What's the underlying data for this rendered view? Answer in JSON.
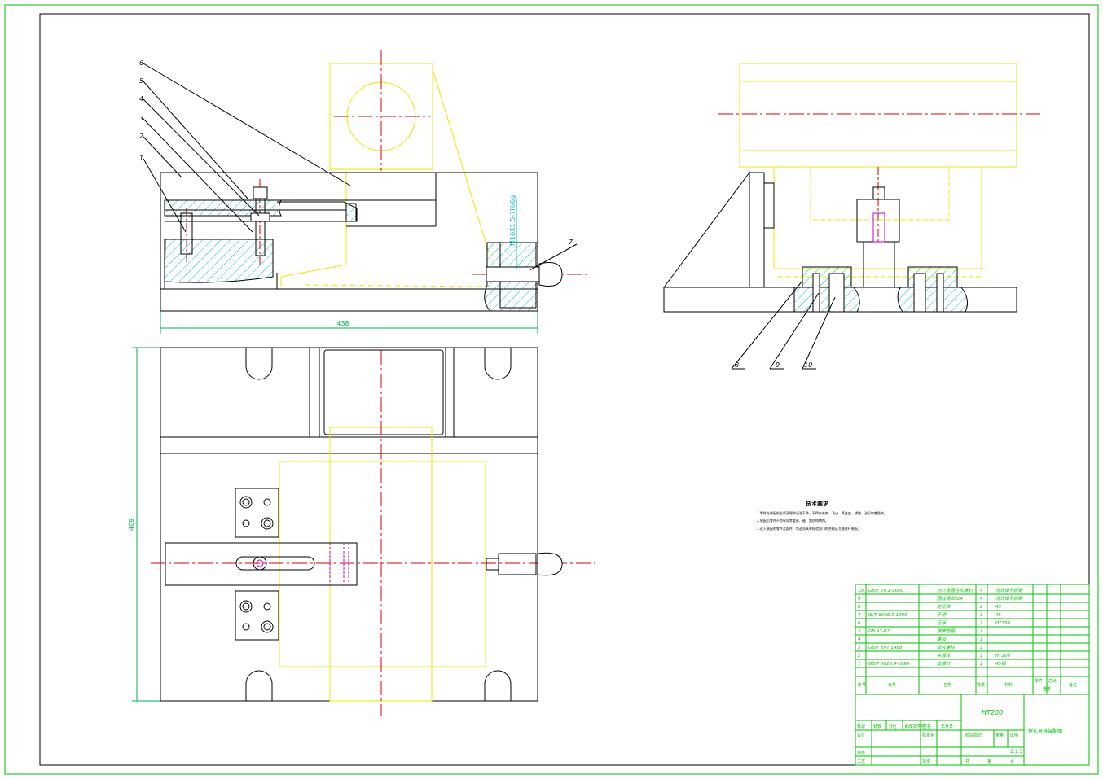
{
  "colors": {
    "border": "#00c000",
    "part": "#000000",
    "workpiece": "#e8e800",
    "center": "#e00000",
    "hatch": "#00c0c0",
    "dimension": "#00b050",
    "detail": "#c000c0",
    "title_block": "#00c000"
  },
  "dimensions": {
    "width": "438",
    "height": "409",
    "thread": "M16X1.5-7H/6g"
  },
  "balloons": {
    "front": [
      "6",
      "5",
      "4",
      "3",
      "2",
      "1",
      "7"
    ],
    "side": [
      "8",
      "9",
      "10"
    ]
  },
  "tech_requirements": {
    "title": "技术要求",
    "lines": [
      "1.零件在装配前必须清理和清洗干净，不得有毛刺、飞边、氧化皮、锈蚀、油污和着色剂。",
      "2.装配后零件不得有异常变形、碰、划伤和锈蚀。",
      "3.进入装配的零件及部件，均必须具有检验部门的合格证方能进行装配。"
    ]
  },
  "bom": {
    "rows": [
      {
        "no": "10",
        "code": "GB/T 70.1-2000",
        "name": "内六角圆柱头螺钉",
        "qty": "4",
        "material": "马氏体不锈钢"
      },
      {
        "no": "9",
        "code": "",
        "name": "圆柱销 8x24",
        "qty": "4",
        "material": "马氏体不锈钢"
      },
      {
        "no": "8",
        "code": "",
        "name": "定位块",
        "qty": "2",
        "material": "45"
      },
      {
        "no": "7",
        "code": "JB/T 8006.0-1999",
        "name": "手柄",
        "qty": "1",
        "material": "45"
      },
      {
        "no": "6",
        "code": "",
        "name": "压板",
        "qty": "1",
        "material": "HT150"
      },
      {
        "no": "5",
        "code": "GB 93-87",
        "name": "弹簧垫圈",
        "qty": "1",
        "material": ""
      },
      {
        "no": "4",
        "code": "",
        "name": "螺母",
        "qty": "1",
        "material": ""
      },
      {
        "no": "3",
        "code": "GB/T 897-1988",
        "name": "双头螺柱",
        "qty": "1",
        "material": ""
      },
      {
        "no": "2",
        "code": "",
        "name": "夹具体",
        "qty": "1",
        "material": "HT200"
      },
      {
        "no": "1",
        "code": "GB/T 8026.4-1999",
        "name": "支撑钉",
        "qty": "1",
        "material": "45钢"
      }
    ],
    "header": {
      "no": "序号",
      "code": "代号",
      "name": "名称",
      "qty": "数量",
      "material": "材料",
      "single": "单件",
      "total": "总计",
      "weight": "重量",
      "note": "备注"
    }
  },
  "title_block": {
    "material": "HT200",
    "drawing_name": "镗孔夹具装配图",
    "scale": "1:1.5",
    "labels": {
      "mark": "标记",
      "count": "处数",
      "zone": "分区",
      "change_doc": "更改文件号",
      "sign": "签名",
      "date": "年月日",
      "design": "设计",
      "standard": "标准化",
      "stage": "阶段标记",
      "weight": "重量",
      "scale": "比例",
      "review": "审核",
      "process": "工艺",
      "approve": "批准",
      "sheets": "共",
      "sheet": "第",
      "page": "页"
    }
  }
}
